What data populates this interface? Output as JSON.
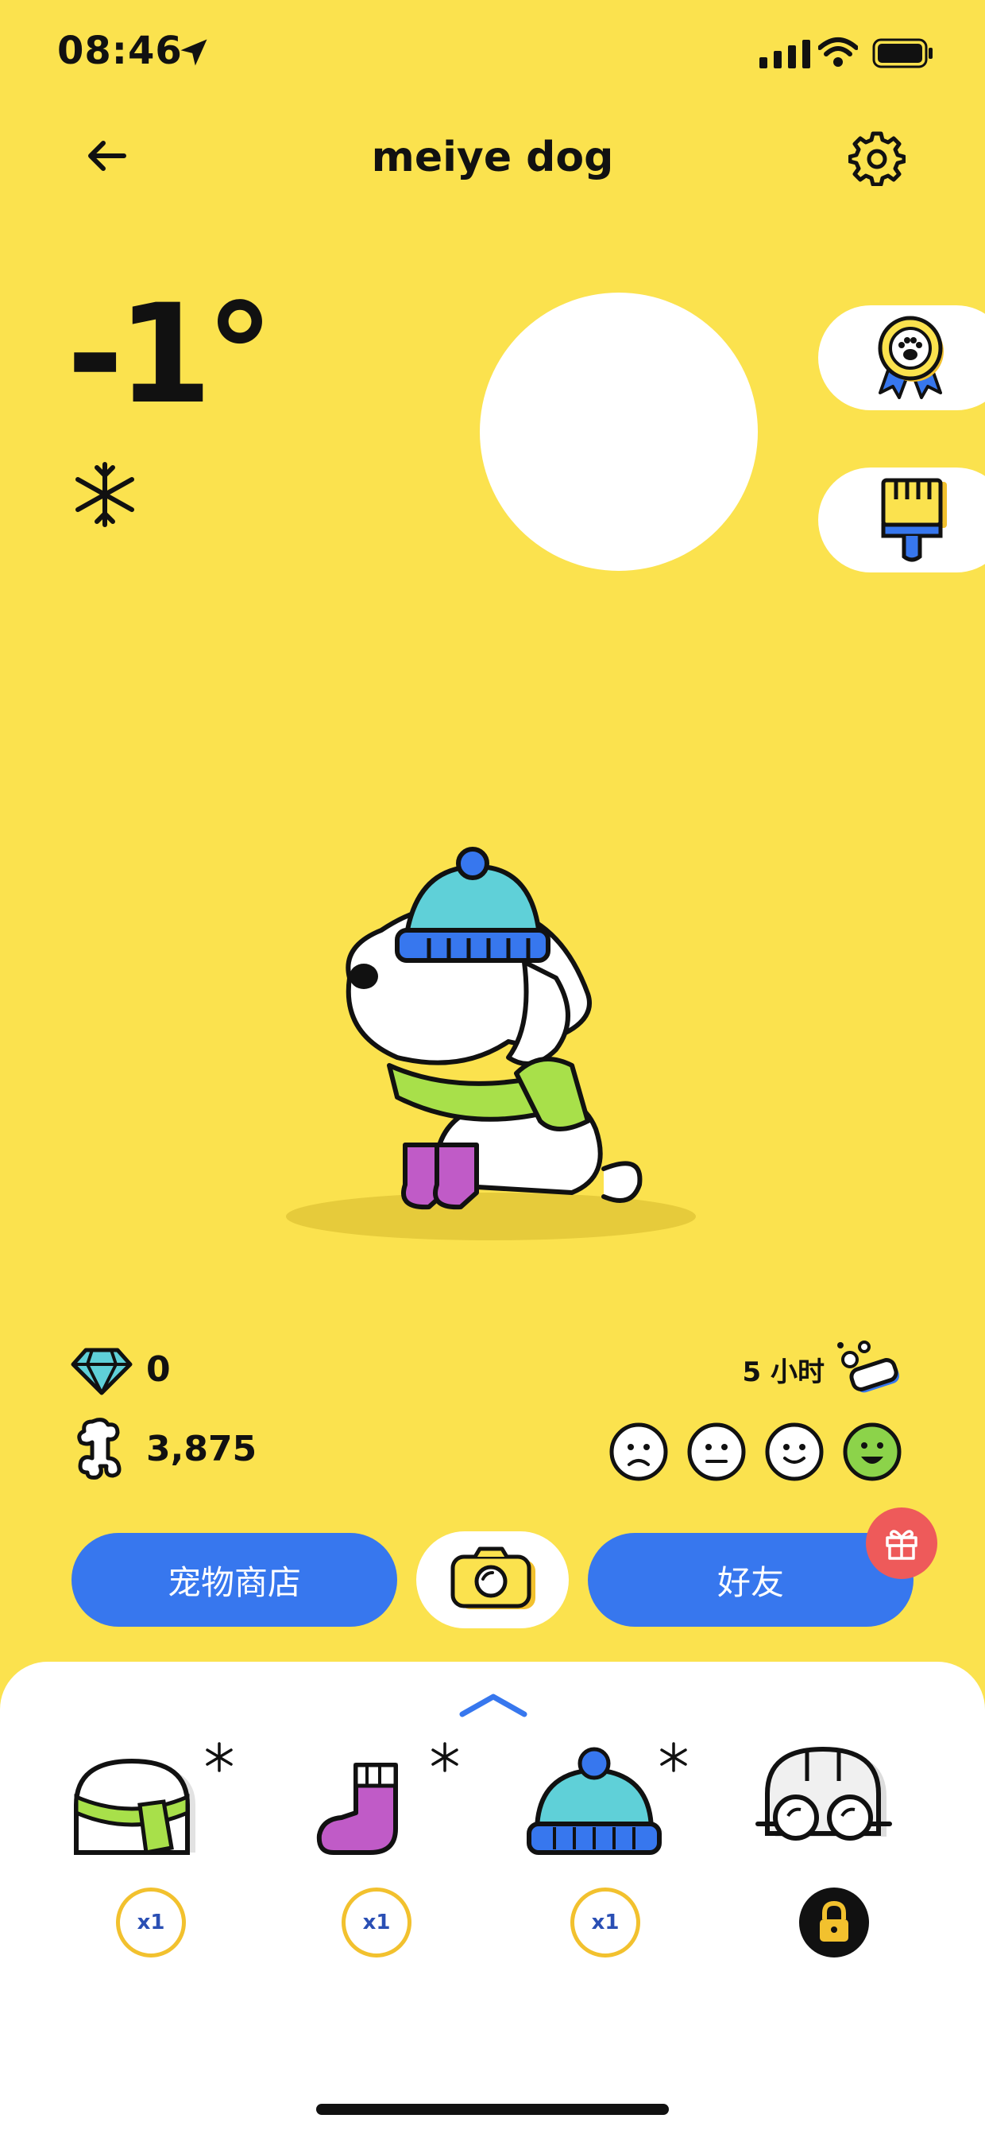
{
  "status_bar": {
    "time": "08:46"
  },
  "header": {
    "title": "meiye dog"
  },
  "weather": {
    "temperature": "-1°",
    "condition_icon": "snowflake-icon"
  },
  "side_buttons": [
    {
      "icon": "award-ribbon-icon"
    },
    {
      "icon": "paint-brush-icon"
    }
  ],
  "stats": {
    "gems": "0",
    "bones": "3,875",
    "timer": "5 小时"
  },
  "moods": [
    "sad",
    "neutral",
    "happy",
    "very-happy"
  ],
  "moods_selected": 3,
  "buttons": {
    "shop": "宠物商店",
    "friends": "好友"
  },
  "inventory": [
    {
      "name": "scarf",
      "count": "x1",
      "winter": true
    },
    {
      "name": "socks",
      "count": "x1",
      "winter": true
    },
    {
      "name": "beanie",
      "count": "x1",
      "winter": true
    },
    {
      "name": "goggles-helmet",
      "locked": true
    }
  ],
  "colors": {
    "background": "#FBE24E",
    "primary_blue": "#3777EE",
    "gift_red": "#EE5A5A",
    "mood_active": "#8CD34A"
  }
}
